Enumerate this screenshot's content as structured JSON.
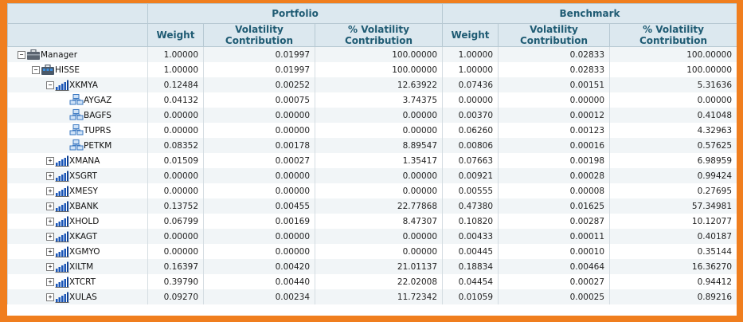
{
  "headers": {
    "portfolio": "Portfolio",
    "benchmark": "Benchmark",
    "weight": "Weight",
    "vol_contrib": "Volatility Contribution",
    "pct_vol_contrib": "% Volatility Contribution"
  },
  "rows": [
    {
      "name": "Manager",
      "level": 0,
      "toggle": "−",
      "icon": "manager-icon",
      "values": [
        "1.00000",
        "0.01997",
        "100.00000",
        "1.00000",
        "0.02833",
        "100.00000"
      ]
    },
    {
      "name": "HISSE",
      "level": 1,
      "toggle": "−",
      "icon": "portfolio-icon",
      "values": [
        "1.00000",
        "0.01997",
        "100.00000",
        "1.00000",
        "0.02833",
        "100.00000"
      ]
    },
    {
      "name": "XKMYA",
      "level": 2,
      "toggle": "−",
      "icon": "sector-icon",
      "values": [
        "0.12484",
        "0.00252",
        "12.63922",
        "0.07436",
        "0.00151",
        "5.31636"
      ]
    },
    {
      "name": "AYGAZ",
      "level": 3,
      "toggle": "",
      "icon": "stock-icon",
      "values": [
        "0.04132",
        "0.00075",
        "3.74375",
        "0.00000",
        "0.00000",
        "0.00000"
      ]
    },
    {
      "name": "BAGFS",
      "level": 3,
      "toggle": "",
      "icon": "stock-icon",
      "values": [
        "0.00000",
        "0.00000",
        "0.00000",
        "0.00370",
        "0.00012",
        "0.41048"
      ]
    },
    {
      "name": "TUPRS",
      "level": 3,
      "toggle": "",
      "icon": "stock-icon",
      "values": [
        "0.00000",
        "0.00000",
        "0.00000",
        "0.06260",
        "0.00123",
        "4.32963"
      ]
    },
    {
      "name": "PETKM",
      "level": 3,
      "toggle": "",
      "icon": "stock-icon",
      "values": [
        "0.08352",
        "0.00178",
        "8.89547",
        "0.00806",
        "0.00016",
        "0.57625"
      ]
    },
    {
      "name": "XMANA",
      "level": 2,
      "toggle": "+",
      "icon": "sector-icon",
      "values": [
        "0.01509",
        "0.00027",
        "1.35417",
        "0.07663",
        "0.00198",
        "6.98959"
      ]
    },
    {
      "name": "XSGRT",
      "level": 2,
      "toggle": "+",
      "icon": "sector-icon",
      "values": [
        "0.00000",
        "0.00000",
        "0.00000",
        "0.00921",
        "0.00028",
        "0.99424"
      ]
    },
    {
      "name": "XMESY",
      "level": 2,
      "toggle": "+",
      "icon": "sector-icon",
      "values": [
        "0.00000",
        "0.00000",
        "0.00000",
        "0.00555",
        "0.00008",
        "0.27695"
      ]
    },
    {
      "name": "XBANK",
      "level": 2,
      "toggle": "+",
      "icon": "sector-icon",
      "values": [
        "0.13752",
        "0.00455",
        "22.77868",
        "0.47380",
        "0.01625",
        "57.34981"
      ]
    },
    {
      "name": "XHOLD",
      "level": 2,
      "toggle": "+",
      "icon": "sector-icon",
      "values": [
        "0.06799",
        "0.00169",
        "8.47307",
        "0.10820",
        "0.00287",
        "10.12077"
      ]
    },
    {
      "name": "XKAGT",
      "level": 2,
      "toggle": "+",
      "icon": "sector-icon",
      "values": [
        "0.00000",
        "0.00000",
        "0.00000",
        "0.00433",
        "0.00011",
        "0.40187"
      ]
    },
    {
      "name": "XGMYO",
      "level": 2,
      "toggle": "+",
      "icon": "sector-icon",
      "values": [
        "0.00000",
        "0.00000",
        "0.00000",
        "0.00445",
        "0.00010",
        "0.35144"
      ]
    },
    {
      "name": "XILTM",
      "level": 2,
      "toggle": "+",
      "icon": "sector-icon",
      "values": [
        "0.16397",
        "0.00420",
        "21.01137",
        "0.18834",
        "0.00464",
        "16.36270"
      ]
    },
    {
      "name": "XTCRT",
      "level": 2,
      "toggle": "+",
      "icon": "sector-icon",
      "values": [
        "0.39790",
        "0.00440",
        "22.02008",
        "0.04454",
        "0.00027",
        "0.94412"
      ]
    },
    {
      "name": "XULAS",
      "level": 2,
      "toggle": "+",
      "icon": "sector-icon",
      "values": [
        "0.09270",
        "0.00234",
        "11.72342",
        "0.01059",
        "0.00025",
        "0.89216"
      ]
    }
  ]
}
